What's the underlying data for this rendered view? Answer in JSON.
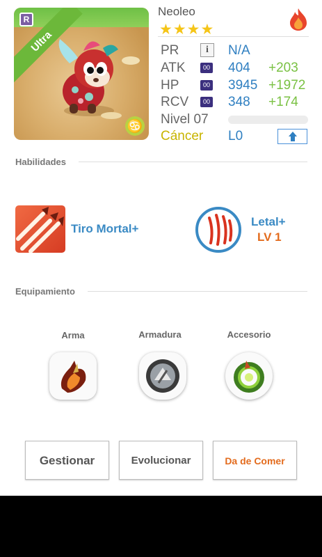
{
  "portrait": {
    "rarity_letter": "R",
    "rank_label": "Ultra",
    "zodiac_symbol": "♋"
  },
  "header": {
    "name": "Neoleo",
    "stars": "★★★★"
  },
  "stats": {
    "pr": {
      "label": "PR",
      "icon": "i",
      "value": "N/A"
    },
    "atk": {
      "label": "ATK",
      "icon": "00",
      "value": "404",
      "bonus": "+203"
    },
    "hp": {
      "label": "HP",
      "icon": "00",
      "value": "3945",
      "bonus": "+1972"
    },
    "rcv": {
      "label": "RCV",
      "icon": "00",
      "value": "348",
      "bonus": "+174"
    },
    "level": {
      "label": "Nivel 07",
      "progress": 0
    },
    "sign": {
      "label": "Cáncer",
      "value": "L0"
    }
  },
  "skills": {
    "section_title": "Habilidades",
    "active_name": "Tiro Mortal+",
    "passive_name": "Letal+",
    "passive_level": "LV 1"
  },
  "equipment": {
    "section_title": "Equipamiento",
    "weapon_label": "Arma",
    "armor_label": "Armadura",
    "accessory_label": "Accesorio"
  },
  "actions": {
    "manage": "Gestionar",
    "evolve": "Evolucionar",
    "feed": "Da de Comer"
  },
  "colors": {
    "accent_blue": "#2f7fc1",
    "bonus_green": "#7ac143",
    "sign_yellow": "#c8b400",
    "feed_orange": "#e36b1d"
  }
}
